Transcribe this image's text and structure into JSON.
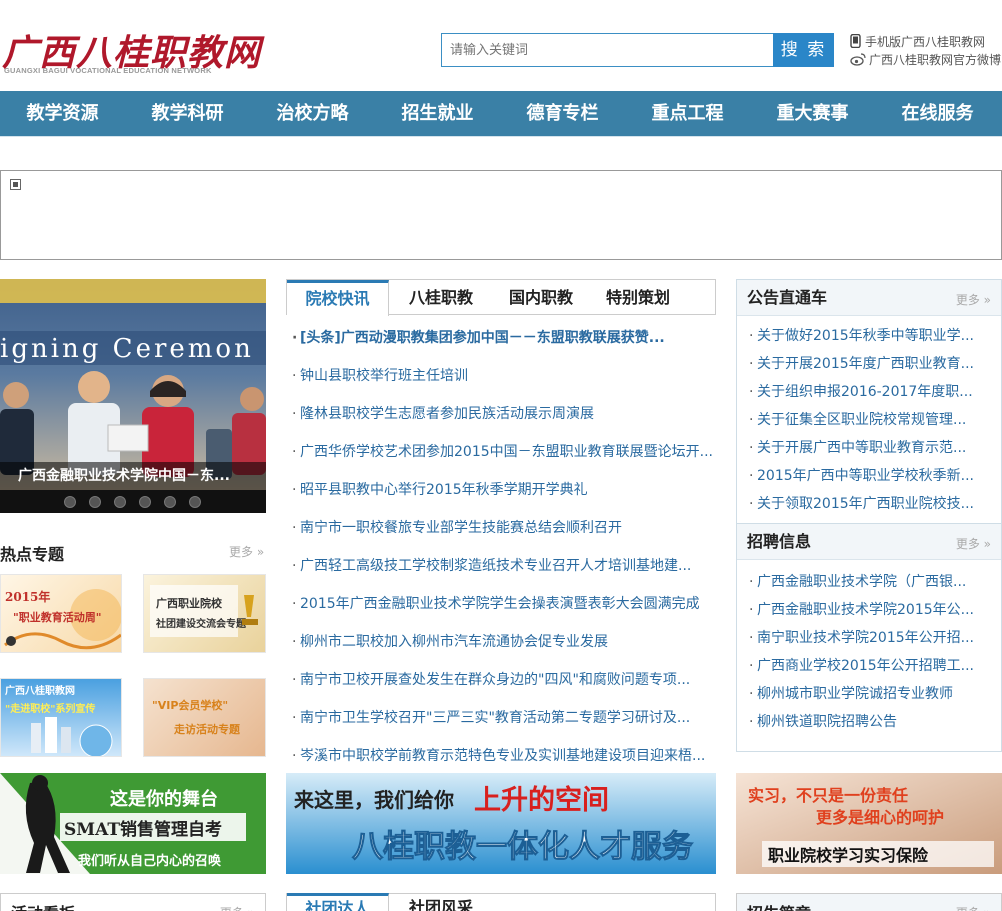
{
  "header": {
    "logo_text": "广西八桂职教网",
    "logo_sub": "GUANGXI BAGUI VOCATIONAL EDUCATION NETWORK",
    "search_placeholder": "请输入关键词",
    "search_button": "搜 索",
    "mobile_link": "手机版广西八桂职教网",
    "weibo_link": "广西八桂职教网官方微博"
  },
  "nav": {
    "items": [
      "教学资源",
      "教学科研",
      "治校方略",
      "招生就业",
      "德育专栏",
      "重点工程",
      "重大赛事",
      "在线服务"
    ]
  },
  "slideshow": {
    "caption": "广西金融职业技术学院中国－东...",
    "banner_text": "igning Ceremon",
    "dot_count": 6
  },
  "hot_topics": {
    "title": "热点专题",
    "more": "更多",
    "promos": [
      {
        "line1": "2015年",
        "line2": "\"职业教育活动周\""
      },
      {
        "line1": "广西职业院校",
        "line2": "社团建设交流会专题"
      },
      {
        "line1": "广西八桂职教网",
        "line2": "\"走进职校\"系列宣传"
      },
      {
        "line1": "\"VIP会员学校\"",
        "line2": "走访活动专题"
      }
    ]
  },
  "news": {
    "tabs": [
      "院校快讯",
      "八桂职教",
      "国内职教",
      "特别策划"
    ],
    "items": [
      "[头条]广西动漫职教集团参加中国－－东盟职教联展获赞...",
      "钟山县职校举行班主任培训",
      "隆林县职校学生志愿者参加民族活动展示周演展",
      "广西华侨学校艺术团参加2015中国－东盟职业教育联展暨论坛开...",
      "昭平县职教中心举行2015年秋季学期开学典礼",
      "南宁市一职校餐旅专业部学生技能赛总结会顺利召开",
      " 广西轻工高级技工学校制浆造纸技术专业召开人才培训基地建...",
      "2015年广西金融职业技术学院学生会操表演暨表彰大会圆满完成",
      "柳州市二职校加入柳州市汽车流通协会促专业发展",
      "南宁市卫校开展查处发生在群众身边的\"四风\"和腐败问题专项...",
      "南宁市卫生学校召开\"三严三实\"教育活动第二专题学习研讨及...",
      "岑溪市中职校学前教育示范特色专业及实训基地建设项目迎来梧..."
    ]
  },
  "notice": {
    "title": "公告直通车",
    "more": "更多",
    "items": [
      "关于做好2015年秋季中等职业学...",
      "关于开展2015年度广西职业教育...",
      "关于组织申报2016-2017年度职...",
      "关于征集全区职业院校常规管理...",
      "关于开展广西中等职业教育示范...",
      "2015年广西中等职业学校秋季新...",
      "关于领取2015年广西职业院校技..."
    ]
  },
  "jobs": {
    "title": "招聘信息",
    "more": "更多",
    "items": [
      "广西金融职业技术学院（广西银...",
      "广西金融职业技术学院2015年公...",
      "南宁职业技术学院2015年公开招...",
      "广西商业学校2015年公开招聘工...",
      "柳州城市职业学院诚招专业教师",
      "柳州铁道职院招聘公告"
    ]
  },
  "ads": {
    "left": {
      "line1": "这是你的舞台",
      "line2": "SMAT销售管理自考",
      "line3": "我们听从自己内心的召唤"
    },
    "middle": {
      "line1": "来这里，我们给你",
      "line1b": "上升的空间",
      "line2": "八桂职教一体化人才服务"
    },
    "right": {
      "line1": "实习，不只是一份责任",
      "line2": "更多是细心的呵护",
      "line3": "职业院校学习实习保险"
    }
  },
  "bottom": {
    "left_title": "活动看板",
    "left_more": "更多",
    "mid_tabs": [
      "社团达人",
      "社团风采"
    ],
    "right_title": "招生简章",
    "right_more": "更多"
  },
  "colors": {
    "nav_bg": "#3a80a6",
    "brand_red": "#b0182b",
    "link_blue": "#2a6aa0",
    "search_blue": "#2a86c8"
  }
}
